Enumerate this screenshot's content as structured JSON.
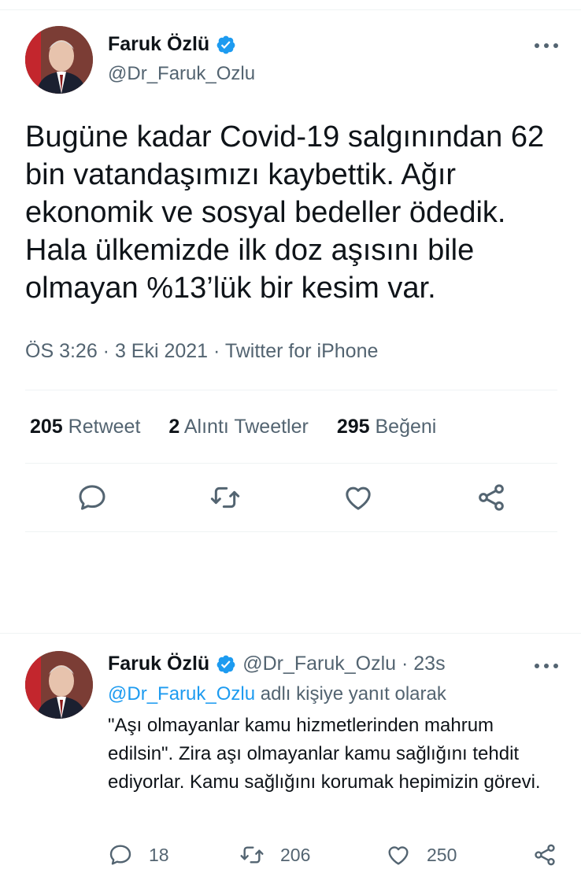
{
  "main": {
    "name": "Faruk Özlü",
    "handle": "@Dr_Faruk_Ozlu",
    "text": "Bugüne kadar Covid-19 salgınından 62 bin vatandaşımızı kaybettik. Ağır ekonomik ve sosyal bedeller ödedik. Hala ülkemizde ilk doz aşısını bile olmayan %13’lük bir kesim var.",
    "meta": "ÖS 3:26 · 3 Eki 2021 · Twitter for iPhone",
    "stats": {
      "retweets_count": "205",
      "retweets_label": "Retweet",
      "quotes_count": "2",
      "quotes_label": "Alıntı Tweetler",
      "likes_count": "295",
      "likes_label": "Beğeni"
    }
  },
  "reply": {
    "name": "Faruk Özlü",
    "handle_time": "@Dr_Faruk_Ozlu · 23s",
    "reply_link": "@Dr_Faruk_Ozlu",
    "reply_suffix": " adlı kişiye yanıt olarak",
    "text": "\"Aşı olmayanlar kamu hizmetlerinden mahrum edilsin\". Zira aşı olmayanlar kamu sağlığını tehdit ediyorlar. Kamu sağlığını korumak hepimizin görevi.",
    "replies": "18",
    "retweets": "206",
    "likes": "250"
  },
  "icons": {
    "reply": "comment-icon",
    "retweet": "retweet-icon",
    "like": "heart-icon",
    "share": "share-icon",
    "verified": "verified-badge-icon",
    "more": "more-icon"
  },
  "colors": {
    "accent": "#1d9bf0",
    "secondary_text": "#536471",
    "primary_text": "#0f1419"
  }
}
